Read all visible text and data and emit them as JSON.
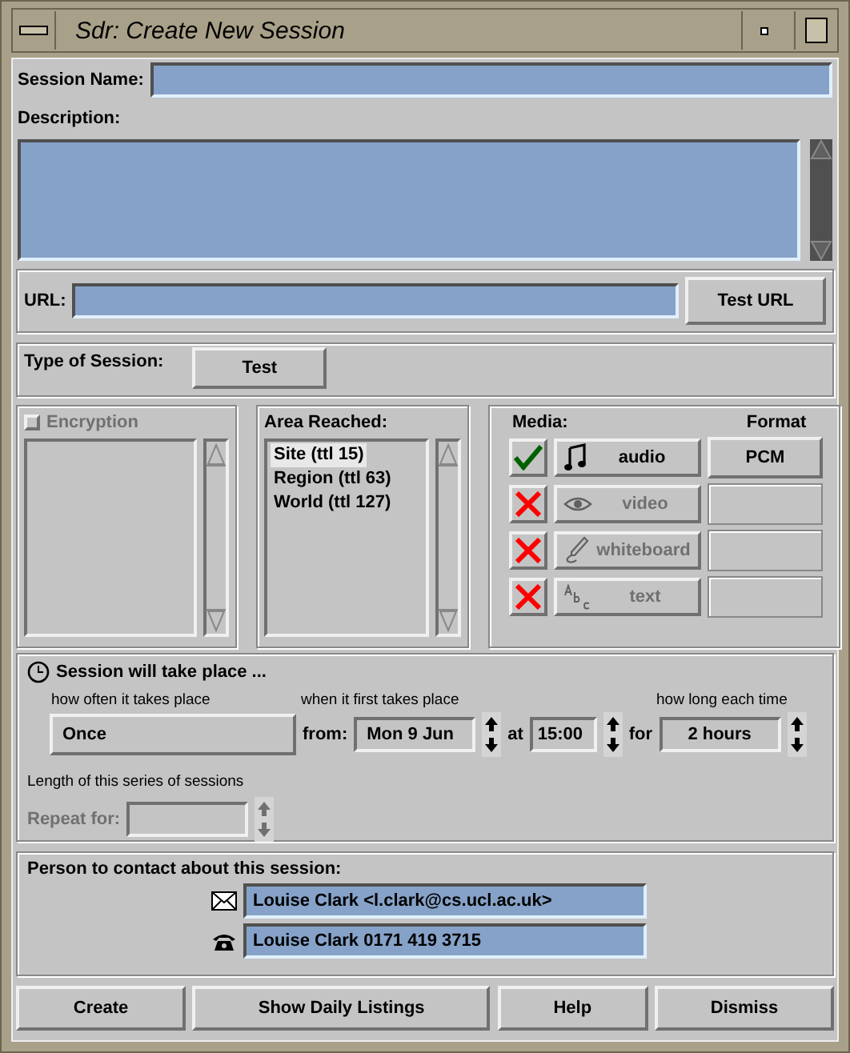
{
  "window": {
    "title": "Sdr: Create New Session"
  },
  "session_name": {
    "label": "Session Name:"
  },
  "description": {
    "label": "Description:"
  },
  "url": {
    "label": "URL:",
    "button": "Test URL"
  },
  "session_type": {
    "label": "Type of Session:",
    "value": "Test"
  },
  "encryption": {
    "label": "Encryption",
    "checked": false,
    "disabled": true
  },
  "area": {
    "label": "Area Reached:",
    "items": [
      {
        "label": "Site (ttl 15)",
        "selected": true
      },
      {
        "label": "Region (ttl 63)",
        "selected": false
      },
      {
        "label": "World (ttl 127)",
        "selected": false
      }
    ]
  },
  "media": {
    "label": "Media:",
    "format_label": "Format",
    "items": [
      {
        "kind": "audio",
        "name": "audio",
        "enabled": true,
        "format": "PCM"
      },
      {
        "kind": "video",
        "name": "video",
        "enabled": false
      },
      {
        "kind": "whiteboard",
        "name": "whiteboard",
        "enabled": false
      },
      {
        "kind": "text",
        "name": "text",
        "enabled": false
      }
    ]
  },
  "schedule": {
    "title": "Session will take place ...",
    "how_often_label": "how often it takes place",
    "how_often": "Once",
    "when_label": "when it first takes place",
    "from_label": "from:",
    "date": "Mon 9 Jun",
    "at_label": "at",
    "time": "15:00",
    "for_label": "for",
    "how_long_label": "how long each time",
    "duration": "2 hours",
    "series_label": "Length of this series of sessions",
    "repeat_label": "Repeat for:",
    "repeat_disabled": true
  },
  "contact": {
    "title": "Person to contact about this session:",
    "email": "Louise Clark <l.clark@cs.ucl.ac.uk>",
    "phone": "Louise Clark 0171 419 3715"
  },
  "buttons": [
    "Create",
    "Show Daily Listings",
    "Help",
    "Dismiss"
  ]
}
